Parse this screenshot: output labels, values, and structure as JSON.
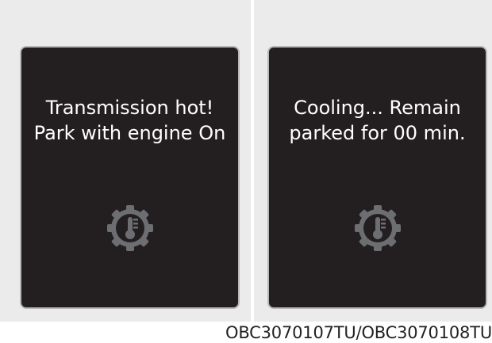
{
  "panels": [
    {
      "message_line1": "Transmission hot!",
      "message_line2": "Park with engine On",
      "icon": "transmission-temperature-icon"
    },
    {
      "message_line1": "Cooling... Remain",
      "message_line2": "parked for 00 min.",
      "icon": "transmission-temperature-icon"
    }
  ],
  "caption": "OBC3070107TU/OBC3070108TU",
  "colors": {
    "screen": "#231f20",
    "text": "#ffffff",
    "icon": "#6d6e71",
    "panel_background": "#ebebeb",
    "screen_border": "#b8b8b8"
  }
}
